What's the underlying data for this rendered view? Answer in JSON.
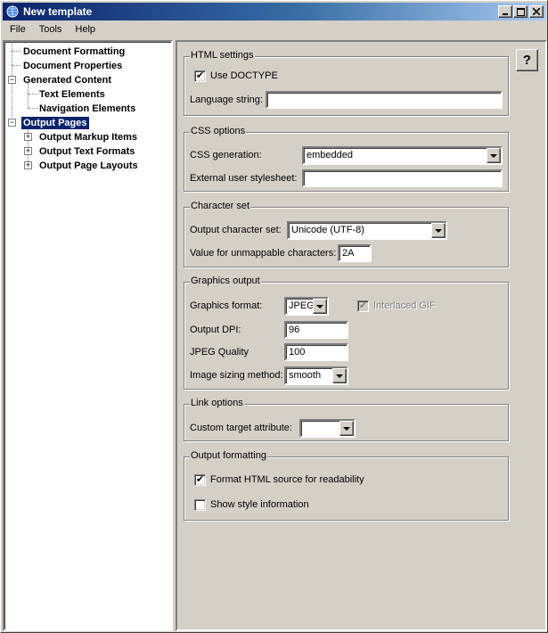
{
  "window": {
    "title": "New template",
    "icon": "app-globe-icon",
    "controls": {
      "minimize": "minimize-icon",
      "maximize": "maximize-icon",
      "close": "close-icon"
    }
  },
  "menu": [
    "File",
    "Tools",
    "Help"
  ],
  "tree": {
    "items": [
      {
        "label": "Document Formatting",
        "level": 1,
        "expander": null,
        "selected": false
      },
      {
        "label": "Document Properties",
        "level": 1,
        "expander": null,
        "selected": false
      },
      {
        "label": "Generated Content",
        "level": 0,
        "expander": "−",
        "selected": false
      },
      {
        "label": "Text Elements",
        "level": 2,
        "expander": null,
        "selected": false
      },
      {
        "label": "Navigation Elements",
        "level": 2,
        "expander": null,
        "selected": false
      },
      {
        "label": "Output Pages",
        "level": 0,
        "expander": "−",
        "selected": true
      },
      {
        "label": "Output Markup Items",
        "level": 1,
        "expander": "+",
        "selected": false
      },
      {
        "label": "Output Text Formats",
        "level": 1,
        "expander": "+",
        "selected": false
      },
      {
        "label": "Output Page Layouts",
        "level": 1,
        "expander": "+",
        "selected": false
      }
    ]
  },
  "help_button": {
    "label": "?",
    "icon": "help-icon"
  },
  "groups": {
    "html": {
      "title": "HTML settings",
      "use_doctype": {
        "label": "Use DOCTYPE",
        "checked": true
      },
      "language_string": {
        "label": "Language string:",
        "value": ""
      }
    },
    "css": {
      "title": "CSS options",
      "generation": {
        "label": "CSS generation:",
        "value": "embedded"
      },
      "external": {
        "label": "External user stylesheet:",
        "value": ""
      }
    },
    "charset": {
      "title": "Character set",
      "output_charset": {
        "label": "Output character set:",
        "value": "Unicode (UTF-8)"
      },
      "unmappable": {
        "label": "Value for unmappable characters:",
        "value": "2A"
      }
    },
    "graphics": {
      "title": "Graphics output",
      "format": {
        "label": "Graphics format:",
        "value": "JPEG"
      },
      "interlaced": {
        "label": "Interlaced GIF",
        "checked": true,
        "disabled": true
      },
      "dpi": {
        "label": "Output DPI:",
        "value": "96"
      },
      "jpeg_quality": {
        "label": "JPEG Quality",
        "value": "100"
      },
      "sizing": {
        "label": "Image sizing method:",
        "value": "smooth"
      }
    },
    "link": {
      "title": "Link options",
      "target": {
        "label": "Custom target attribute:",
        "value": ""
      }
    },
    "formatting": {
      "title": "Output formatting",
      "readability": {
        "label": "Format HTML source for readability",
        "checked": true
      },
      "style_info": {
        "label": "Show style information",
        "checked": false
      }
    }
  },
  "glyphs": {
    "check": "✔"
  }
}
